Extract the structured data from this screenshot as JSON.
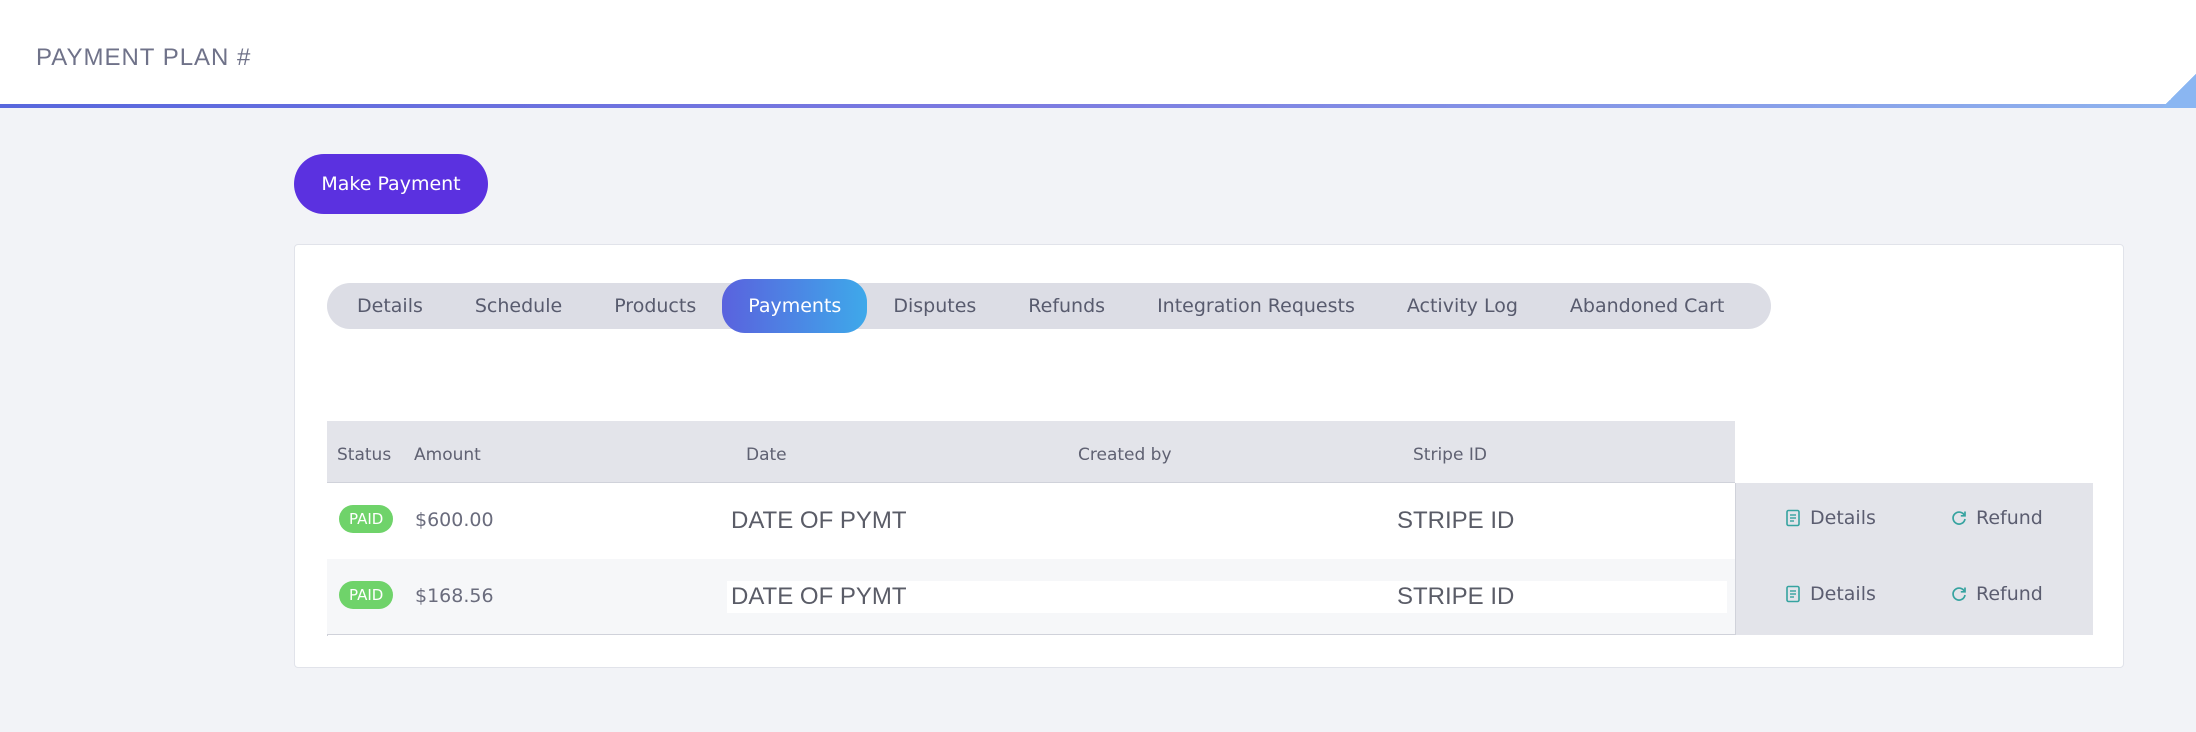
{
  "header": {
    "title": "PAYMENT PLAN #"
  },
  "make_payment_label": "Make Payment",
  "tabs": [
    {
      "label": "Details"
    },
    {
      "label": "Schedule"
    },
    {
      "label": "Products"
    },
    {
      "label": "Payments",
      "active": true
    },
    {
      "label": "Disputes"
    },
    {
      "label": "Refunds"
    },
    {
      "label": "Integration Requests"
    },
    {
      "label": "Activity Log"
    },
    {
      "label": "Abandoned Cart"
    }
  ],
  "table": {
    "columns": [
      "Status",
      "Amount",
      "Date",
      "Created by",
      "Stripe ID"
    ],
    "rows": [
      {
        "status": "PAID",
        "amount": "$600.00",
        "date": "DATE OF PYMT",
        "created_by": "",
        "stripe_id": "STRIPE ID",
        "details_label": "Details",
        "refund_label": "Refund"
      },
      {
        "status": "PAID",
        "amount": "$168.56",
        "date": "DATE OF PYMT",
        "created_by": "",
        "stripe_id": "STRIPE ID",
        "details_label": "Details",
        "refund_label": "Refund"
      }
    ]
  },
  "colors": {
    "accent": "#5b31e0",
    "tab_active_start": "#5a62de",
    "tab_active_end": "#3ea9ea",
    "badge_paid": "#6fd36a",
    "icon_teal": "#36a3a0"
  },
  "icons": {
    "details": "document-icon",
    "refund": "refresh-icon"
  }
}
